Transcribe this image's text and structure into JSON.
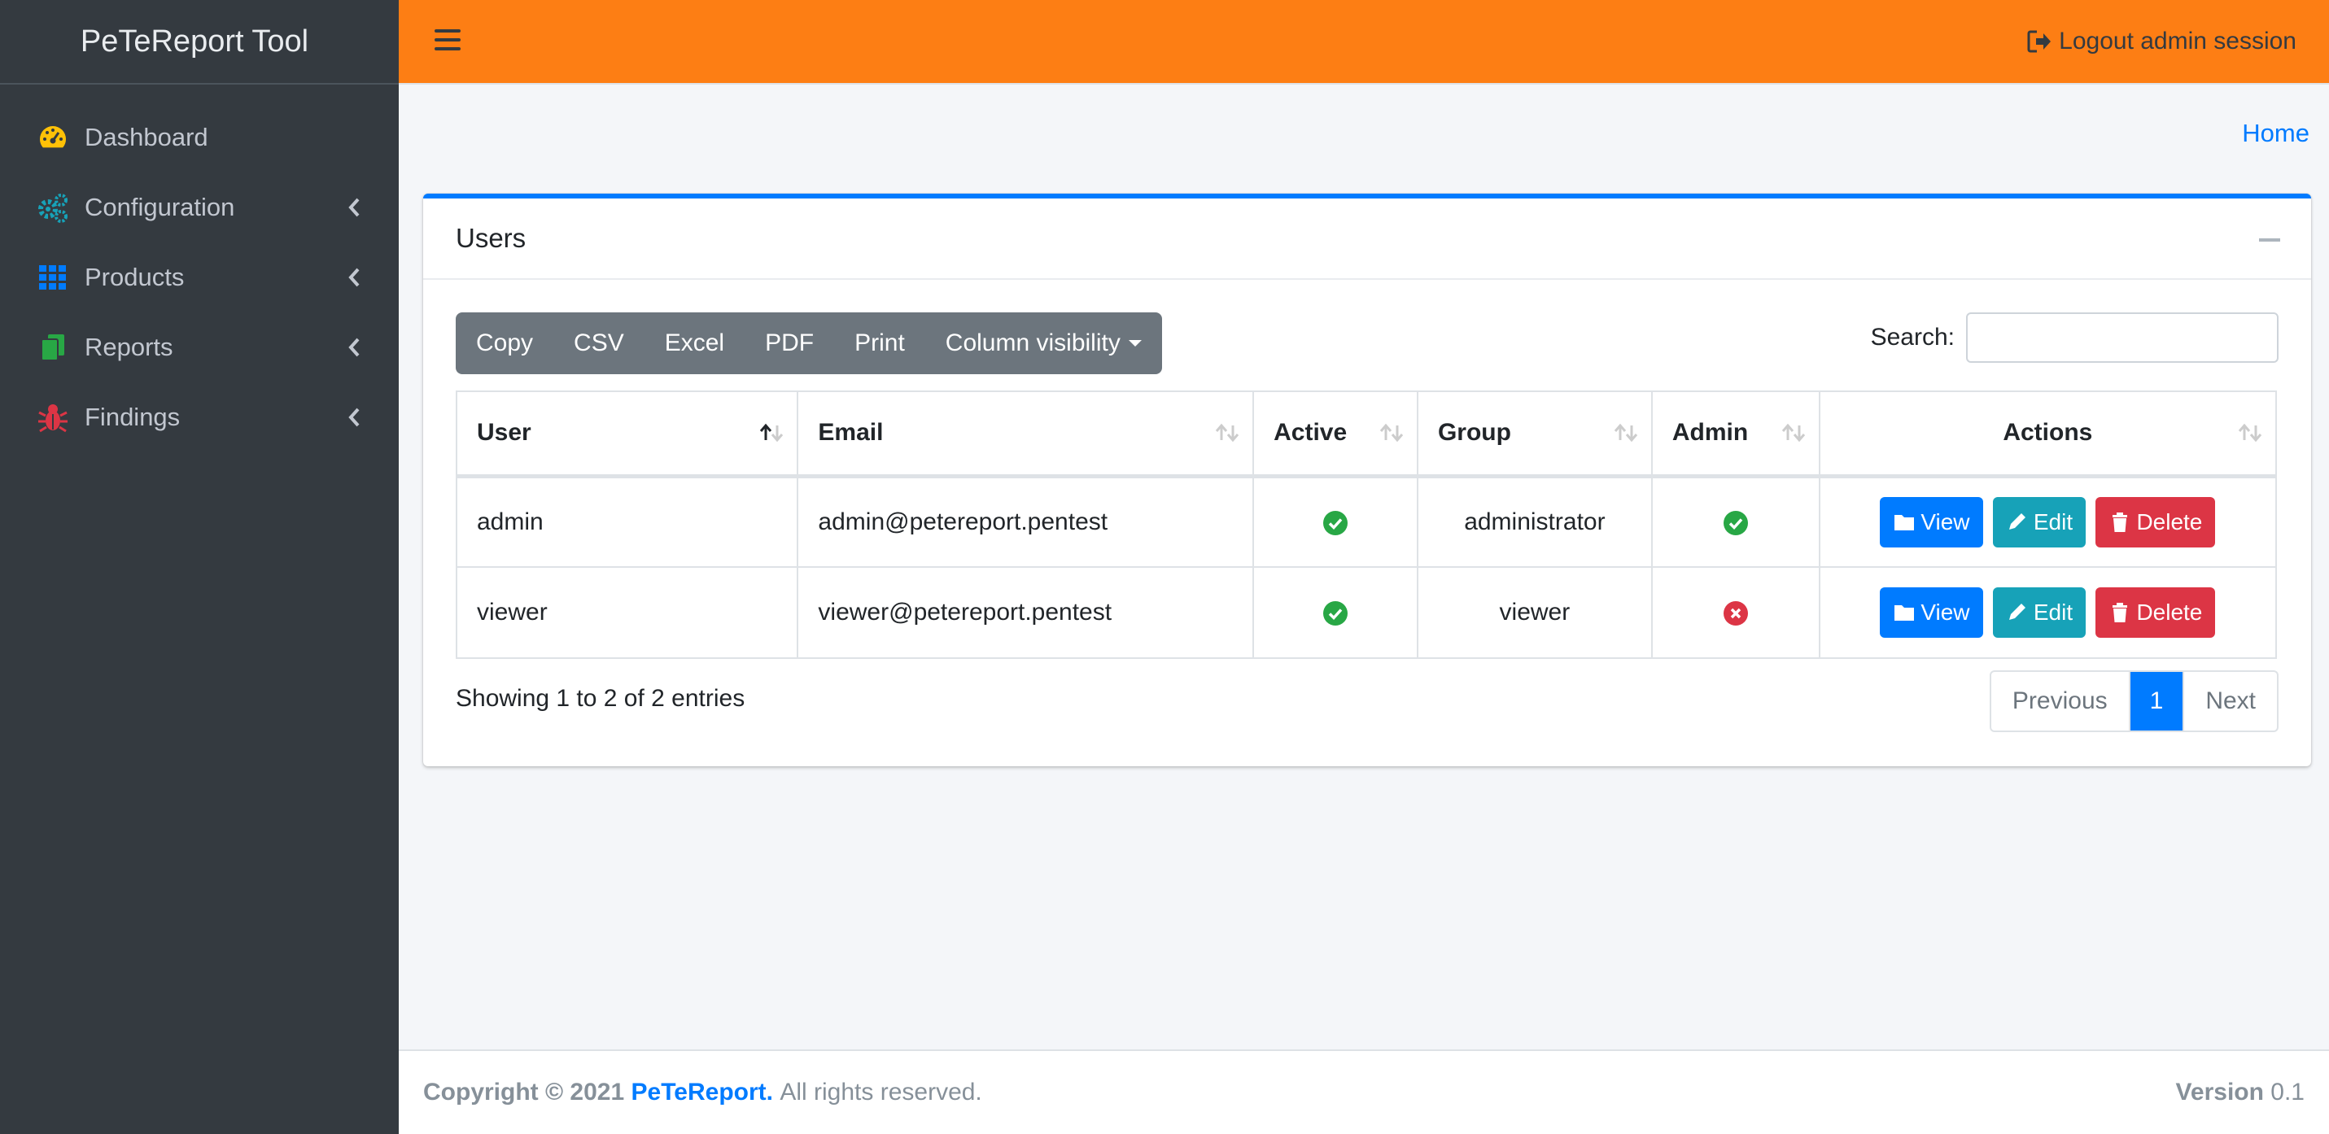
{
  "brand": "PeTeReport Tool",
  "sidebar": {
    "items": [
      {
        "label": "Dashboard",
        "icon": "tachometer-icon",
        "color": "#ffc107"
      },
      {
        "label": "Configuration",
        "icon": "cogs-icon",
        "color": "#17a2b8"
      },
      {
        "label": "Products",
        "icon": "grid-icon",
        "color": "#007bff"
      },
      {
        "label": "Reports",
        "icon": "copy-icon",
        "color": "#28a745"
      },
      {
        "label": "Findings",
        "icon": "bug-icon",
        "color": "#dc3545"
      }
    ]
  },
  "header": {
    "logout_label": "Logout admin session",
    "accent": "#fd7e14"
  },
  "breadcrumb": "Home",
  "card": {
    "title": "Users",
    "toolbar": [
      "Copy",
      "CSV",
      "Excel",
      "PDF",
      "Print",
      "Column visibility"
    ],
    "search_label": "Search:",
    "search_value": ""
  },
  "table": {
    "columns": [
      "User",
      "Email",
      "Active",
      "Group",
      "Admin",
      "Actions"
    ],
    "rows": [
      {
        "user": "admin",
        "email": "admin@petereport.pentest",
        "active": true,
        "group": "administrator",
        "admin": true
      },
      {
        "user": "viewer",
        "email": "viewer@petereport.pentest",
        "active": true,
        "group": "viewer",
        "admin": false
      }
    ],
    "actions": {
      "view": "View",
      "edit": "Edit",
      "delete": "Delete"
    }
  },
  "info": "Showing 1 to 2 of 2 entries",
  "pagination": {
    "previous": "Previous",
    "page": "1",
    "next": "Next"
  },
  "footer": {
    "copyright": "Copyright © 2021",
    "brand": "PeTeReport.",
    "rights": "All rights reserved.",
    "version_label": "Version",
    "version_value": "0.1"
  }
}
